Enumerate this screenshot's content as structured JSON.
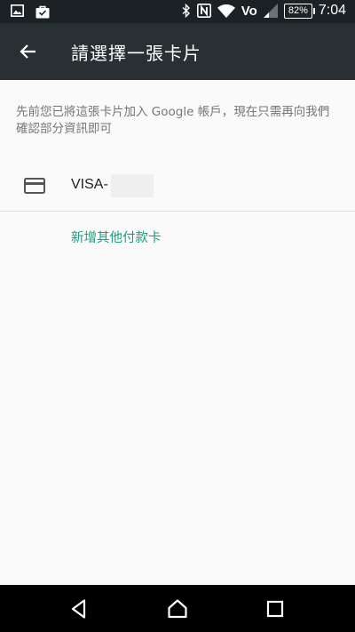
{
  "status_bar": {
    "time": "7:04",
    "battery": "82%",
    "network_label": "Vo",
    "icons": [
      "image-icon",
      "bag-icon",
      "bluetooth-icon",
      "nfc-icon",
      "wifi-icon",
      "volte-icon",
      "signal-icon",
      "battery-icon"
    ]
  },
  "app_bar": {
    "title": "請選擇一張卡片",
    "back_icon": "arrow-back-icon"
  },
  "subtitle": "先前您已將這張卡片加入 Google 帳戶，現在只需再向我們確認部分資訊即可",
  "card": {
    "label": "VISA-",
    "icon": "credit-card-icon"
  },
  "add_link": "新增其他付款卡",
  "colors": {
    "status_bar": "#1c2125",
    "app_bar": "#283034",
    "accent": "#1a9d86",
    "background": "#fafafa"
  },
  "nav_bar": {
    "icons": [
      "back-triangle-icon",
      "home-icon",
      "recents-icon"
    ]
  }
}
